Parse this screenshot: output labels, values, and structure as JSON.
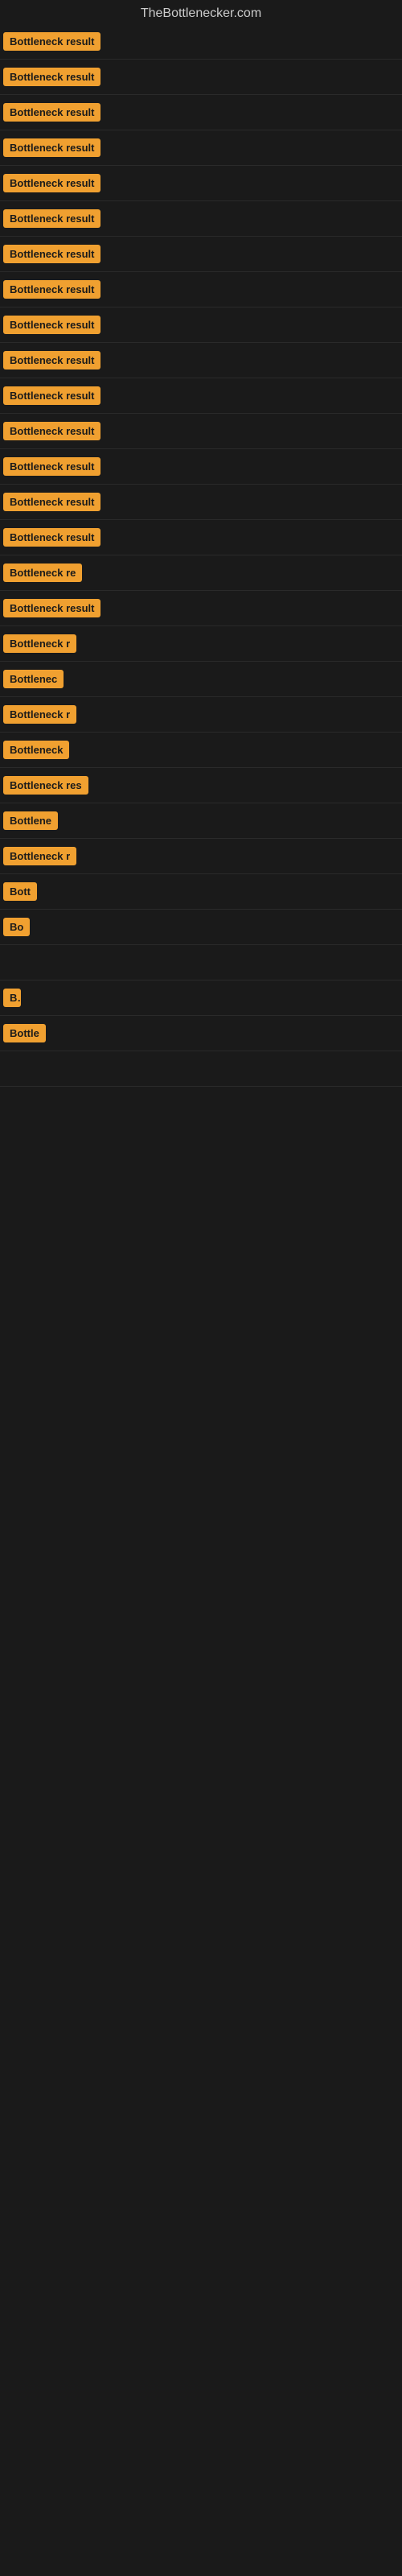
{
  "header": {
    "title": "TheBottlenecker.com"
  },
  "rows": [
    {
      "badge": "Bottleneck result",
      "width": 130
    },
    {
      "badge": "Bottleneck result",
      "width": 130
    },
    {
      "badge": "Bottleneck result",
      "width": 130
    },
    {
      "badge": "Bottleneck result",
      "width": 130
    },
    {
      "badge": "Bottleneck result",
      "width": 130
    },
    {
      "badge": "Bottleneck result",
      "width": 130
    },
    {
      "badge": "Bottleneck result",
      "width": 130
    },
    {
      "badge": "Bottleneck result",
      "width": 130
    },
    {
      "badge": "Bottleneck result",
      "width": 130
    },
    {
      "badge": "Bottleneck result",
      "width": 130
    },
    {
      "badge": "Bottleneck result",
      "width": 130
    },
    {
      "badge": "Bottleneck result",
      "width": 130
    },
    {
      "badge": "Bottleneck result",
      "width": 130
    },
    {
      "badge": "Bottleneck result",
      "width": 130
    },
    {
      "badge": "Bottleneck result",
      "width": 130
    },
    {
      "badge": "Bottleneck re",
      "width": 105
    },
    {
      "badge": "Bottleneck result",
      "width": 128
    },
    {
      "badge": "Bottleneck r",
      "width": 100
    },
    {
      "badge": "Bottlenec",
      "width": 88
    },
    {
      "badge": "Bottleneck r",
      "width": 100
    },
    {
      "badge": "Bottleneck",
      "width": 90
    },
    {
      "badge": "Bottleneck res",
      "width": 110
    },
    {
      "badge": "Bottlene",
      "width": 82
    },
    {
      "badge": "Bottleneck r",
      "width": 98
    },
    {
      "badge": "Bott",
      "width": 50
    },
    {
      "badge": "Bo",
      "width": 36
    },
    {
      "badge": "",
      "width": 10
    },
    {
      "badge": "B",
      "width": 22
    },
    {
      "badge": "Bottle",
      "width": 58
    },
    {
      "badge": "",
      "width": 8
    }
  ]
}
